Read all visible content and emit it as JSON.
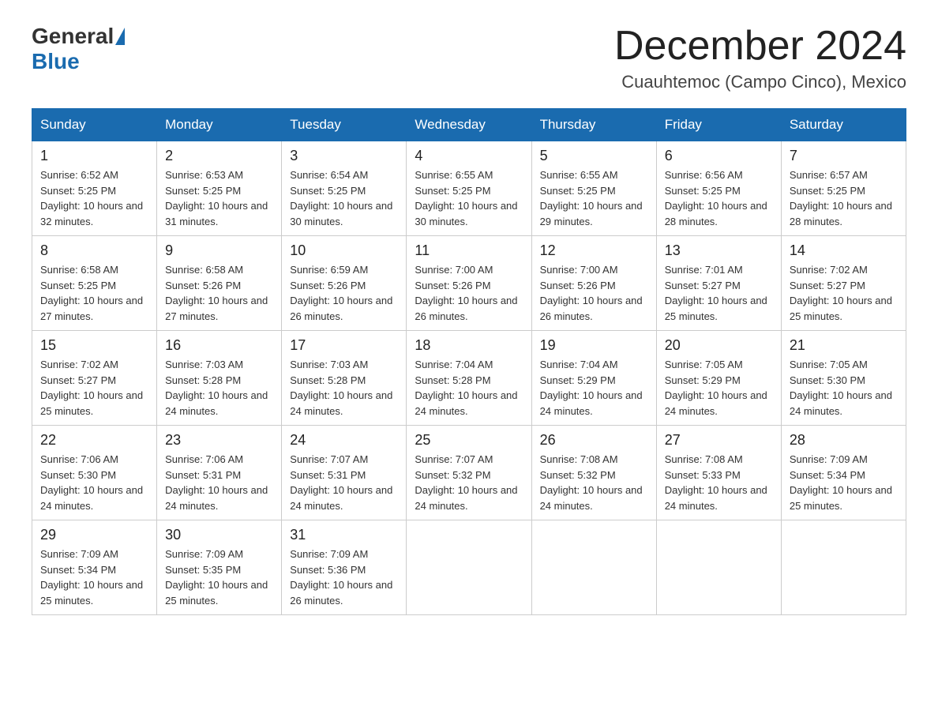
{
  "header": {
    "logo": {
      "text1": "General",
      "text2": "Blue"
    },
    "title": "December 2024",
    "subtitle": "Cuauhtemoc (Campo Cinco), Mexico"
  },
  "days_of_week": [
    "Sunday",
    "Monday",
    "Tuesday",
    "Wednesday",
    "Thursday",
    "Friday",
    "Saturday"
  ],
  "weeks": [
    [
      {
        "day": "1",
        "sunrise": "6:52 AM",
        "sunset": "5:25 PM",
        "daylight": "10 hours and 32 minutes."
      },
      {
        "day": "2",
        "sunrise": "6:53 AM",
        "sunset": "5:25 PM",
        "daylight": "10 hours and 31 minutes."
      },
      {
        "day": "3",
        "sunrise": "6:54 AM",
        "sunset": "5:25 PM",
        "daylight": "10 hours and 30 minutes."
      },
      {
        "day": "4",
        "sunrise": "6:55 AM",
        "sunset": "5:25 PM",
        "daylight": "10 hours and 30 minutes."
      },
      {
        "day": "5",
        "sunrise": "6:55 AM",
        "sunset": "5:25 PM",
        "daylight": "10 hours and 29 minutes."
      },
      {
        "day": "6",
        "sunrise": "6:56 AM",
        "sunset": "5:25 PM",
        "daylight": "10 hours and 28 minutes."
      },
      {
        "day": "7",
        "sunrise": "6:57 AM",
        "sunset": "5:25 PM",
        "daylight": "10 hours and 28 minutes."
      }
    ],
    [
      {
        "day": "8",
        "sunrise": "6:58 AM",
        "sunset": "5:25 PM",
        "daylight": "10 hours and 27 minutes."
      },
      {
        "day": "9",
        "sunrise": "6:58 AM",
        "sunset": "5:26 PM",
        "daylight": "10 hours and 27 minutes."
      },
      {
        "day": "10",
        "sunrise": "6:59 AM",
        "sunset": "5:26 PM",
        "daylight": "10 hours and 26 minutes."
      },
      {
        "day": "11",
        "sunrise": "7:00 AM",
        "sunset": "5:26 PM",
        "daylight": "10 hours and 26 minutes."
      },
      {
        "day": "12",
        "sunrise": "7:00 AM",
        "sunset": "5:26 PM",
        "daylight": "10 hours and 26 minutes."
      },
      {
        "day": "13",
        "sunrise": "7:01 AM",
        "sunset": "5:27 PM",
        "daylight": "10 hours and 25 minutes."
      },
      {
        "day": "14",
        "sunrise": "7:02 AM",
        "sunset": "5:27 PM",
        "daylight": "10 hours and 25 minutes."
      }
    ],
    [
      {
        "day": "15",
        "sunrise": "7:02 AM",
        "sunset": "5:27 PM",
        "daylight": "10 hours and 25 minutes."
      },
      {
        "day": "16",
        "sunrise": "7:03 AM",
        "sunset": "5:28 PM",
        "daylight": "10 hours and 24 minutes."
      },
      {
        "day": "17",
        "sunrise": "7:03 AM",
        "sunset": "5:28 PM",
        "daylight": "10 hours and 24 minutes."
      },
      {
        "day": "18",
        "sunrise": "7:04 AM",
        "sunset": "5:28 PM",
        "daylight": "10 hours and 24 minutes."
      },
      {
        "day": "19",
        "sunrise": "7:04 AM",
        "sunset": "5:29 PM",
        "daylight": "10 hours and 24 minutes."
      },
      {
        "day": "20",
        "sunrise": "7:05 AM",
        "sunset": "5:29 PM",
        "daylight": "10 hours and 24 minutes."
      },
      {
        "day": "21",
        "sunrise": "7:05 AM",
        "sunset": "5:30 PM",
        "daylight": "10 hours and 24 minutes."
      }
    ],
    [
      {
        "day": "22",
        "sunrise": "7:06 AM",
        "sunset": "5:30 PM",
        "daylight": "10 hours and 24 minutes."
      },
      {
        "day": "23",
        "sunrise": "7:06 AM",
        "sunset": "5:31 PM",
        "daylight": "10 hours and 24 minutes."
      },
      {
        "day": "24",
        "sunrise": "7:07 AM",
        "sunset": "5:31 PM",
        "daylight": "10 hours and 24 minutes."
      },
      {
        "day": "25",
        "sunrise": "7:07 AM",
        "sunset": "5:32 PM",
        "daylight": "10 hours and 24 minutes."
      },
      {
        "day": "26",
        "sunrise": "7:08 AM",
        "sunset": "5:32 PM",
        "daylight": "10 hours and 24 minutes."
      },
      {
        "day": "27",
        "sunrise": "7:08 AM",
        "sunset": "5:33 PM",
        "daylight": "10 hours and 24 minutes."
      },
      {
        "day": "28",
        "sunrise": "7:09 AM",
        "sunset": "5:34 PM",
        "daylight": "10 hours and 25 minutes."
      }
    ],
    [
      {
        "day": "29",
        "sunrise": "7:09 AM",
        "sunset": "5:34 PM",
        "daylight": "10 hours and 25 minutes."
      },
      {
        "day": "30",
        "sunrise": "7:09 AM",
        "sunset": "5:35 PM",
        "daylight": "10 hours and 25 minutes."
      },
      {
        "day": "31",
        "sunrise": "7:09 AM",
        "sunset": "5:36 PM",
        "daylight": "10 hours and 26 minutes."
      },
      null,
      null,
      null,
      null
    ]
  ]
}
